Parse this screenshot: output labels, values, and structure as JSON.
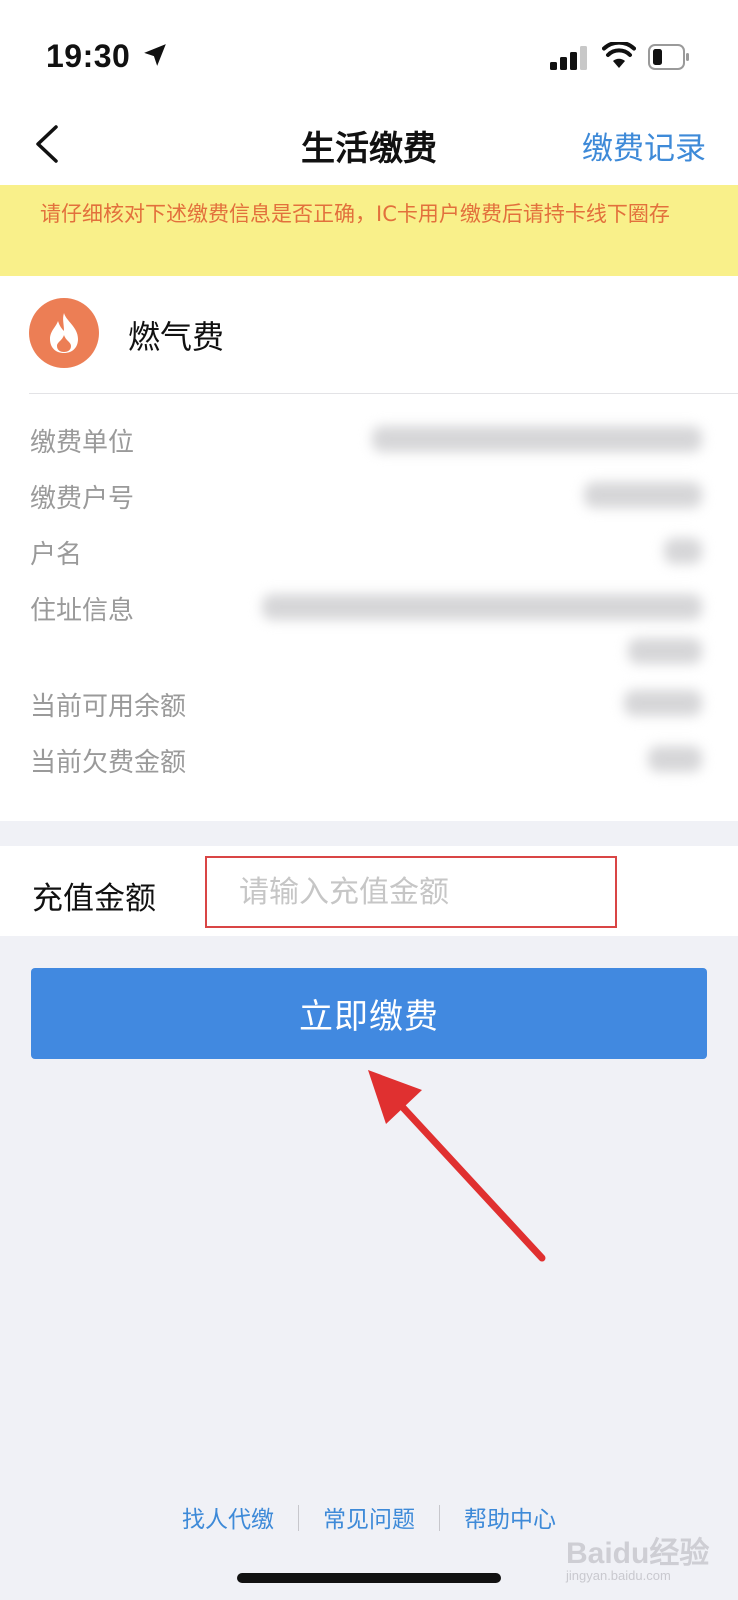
{
  "status_bar": {
    "time": "19:30",
    "icons": [
      "location-arrow-icon",
      "signal-icon",
      "wifi-icon",
      "battery-icon"
    ]
  },
  "nav": {
    "title": "生活缴费",
    "record_link": "缴费记录",
    "back_icon": "chevron-left-icon"
  },
  "notice": {
    "text": "请仔细核对下述缴费信息是否正确，IC卡用户缴费后请持卡线下圈存"
  },
  "biller": {
    "name": "燃气费",
    "icon": "flame-icon",
    "icon_color": "#ec7e55"
  },
  "info": {
    "labels": [
      "缴费单位",
      "缴费户号",
      "户名",
      "住址信息",
      "当前可用余额",
      "当前欠费金额"
    ]
  },
  "recharge": {
    "label": "充值金额",
    "value": "",
    "placeholder": "请输入充值金额"
  },
  "pay_button": {
    "label": "立即缴费",
    "color": "#4189e0"
  },
  "footer": {
    "links": [
      "找人代缴",
      "常见问题",
      "帮助中心"
    ]
  },
  "watermark": {
    "brand": "Baidu经验",
    "domain": "jingyan.baidu.com"
  },
  "colors": {
    "accent": "#3e8ad8",
    "notice_bg": "#f9f08a",
    "notice_text": "#e2703c",
    "annotation_red": "#d94545"
  }
}
